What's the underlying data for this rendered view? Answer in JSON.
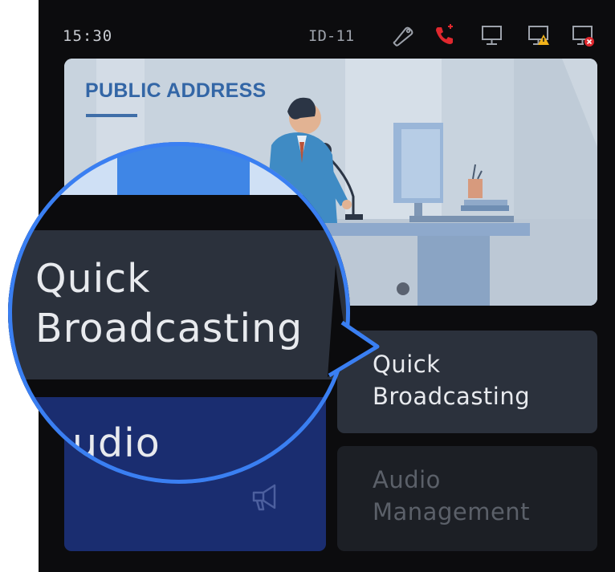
{
  "status_bar": {
    "time": "15:30",
    "device_id": "ID-11",
    "icons": [
      "tag-icon",
      "phone-alert-icon",
      "monitor-icon",
      "monitor-warning-icon",
      "monitor-error-icon"
    ]
  },
  "banner": {
    "title": "PUBLIC ADDRESS",
    "illustration": "person-speaking-into-microphone"
  },
  "tiles": {
    "quick_broadcasting": "Quick\nBroadcasting",
    "audio_management": "Audio\nManagement",
    "main_icon": "megaphone-icon"
  },
  "magnifier": {
    "label_primary": "Quick\nBroadcasting",
    "label_secondary": "udio"
  },
  "colors": {
    "accent_ring": "#3a7ff2",
    "banner_title": "#3366a6",
    "tile_main": "#1a2d70",
    "tile_secondary": "#2b313c",
    "alert_red": "#e0282e",
    "warning_yellow": "#f1b21a"
  }
}
